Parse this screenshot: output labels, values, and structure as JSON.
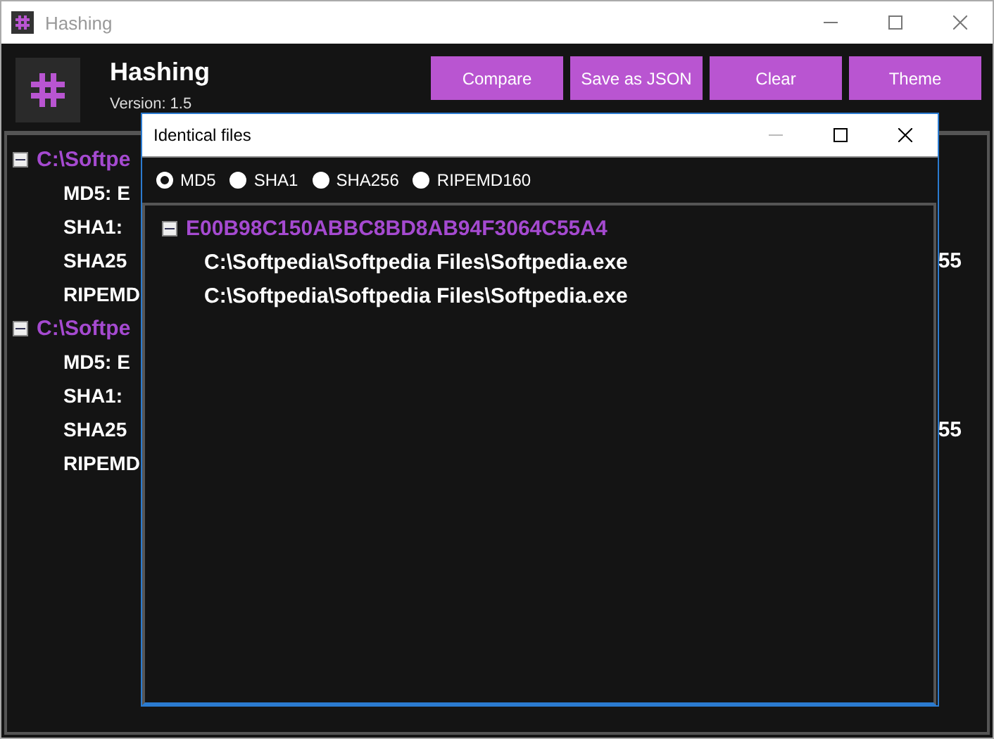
{
  "window": {
    "title": "Hashing"
  },
  "header": {
    "title": "Hashing",
    "version": "Version: 1.5"
  },
  "buttons": [
    "Compare",
    "Save as JSON",
    "Clear",
    "Theme"
  ],
  "tree": [
    {
      "label": "C:\\Softpe",
      "expanded": true,
      "children": [
        {
          "label": "MD5: E"
        },
        {
          "label": "SHA1:"
        },
        {
          "label": "SHA25",
          "tail": "55"
        },
        {
          "label": "RIPEMD"
        }
      ]
    },
    {
      "label": "C:\\Softpe",
      "expanded": true,
      "children": [
        {
          "label": "MD5: E"
        },
        {
          "label": "SHA1:"
        },
        {
          "label": "SHA25",
          "tail": "55"
        },
        {
          "label": "RIPEMD"
        }
      ]
    }
  ],
  "dialog": {
    "title": "Identical files",
    "algorithms": [
      {
        "label": "MD5",
        "selected": true
      },
      {
        "label": "SHA1",
        "selected": false
      },
      {
        "label": "SHA256",
        "selected": false
      },
      {
        "label": "RIPEMD160",
        "selected": false
      }
    ],
    "groups": [
      {
        "hash": "E00B98C150ABBC8BD8AB94F3064C55A4",
        "expanded": true,
        "files": [
          "C:\\Softpedia\\Softpedia Files\\Softpedia.exe",
          "C:\\Softpedia\\Softpedia Files\\Softpedia.exe"
        ]
      }
    ]
  }
}
